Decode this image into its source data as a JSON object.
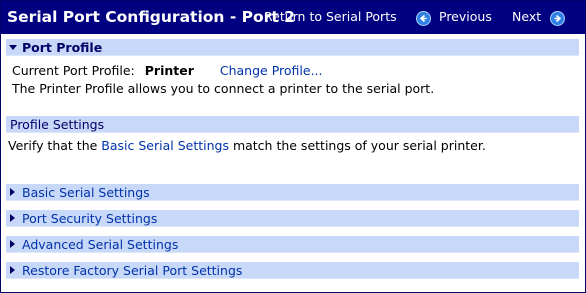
{
  "window": {
    "title": "Serial Port Configuration - Port 2"
  },
  "nav": {
    "return_label": "Return to Serial Ports",
    "previous_label": "Previous",
    "next_label": "Next",
    "previous_icon": "arrow-left-circle-icon",
    "next_icon": "arrow-right-circle-icon"
  },
  "port_profile": {
    "heading": "Port Profile",
    "current_label": "Current Port Profile:",
    "current_value": "Printer",
    "change_link": "Change Profile...",
    "description": "The Printer Profile allows you to connect a printer to the serial port."
  },
  "profile_settings": {
    "heading": "Profile Settings",
    "text_before": "Verify that the ",
    "text_link": "Basic Serial Settings",
    "text_after": " match the settings of your serial printer."
  },
  "sections": [
    {
      "label": "Basic Serial Settings"
    },
    {
      "label": "Port Security Settings"
    },
    {
      "label": "Advanced Serial Settings"
    },
    {
      "label": "Restore Factory Serial Port Settings"
    }
  ],
  "colors": {
    "titlebar": "#000080",
    "band": "#c8d8f8",
    "link": "#0033aa",
    "nav_icon": "#2f7fe6"
  }
}
